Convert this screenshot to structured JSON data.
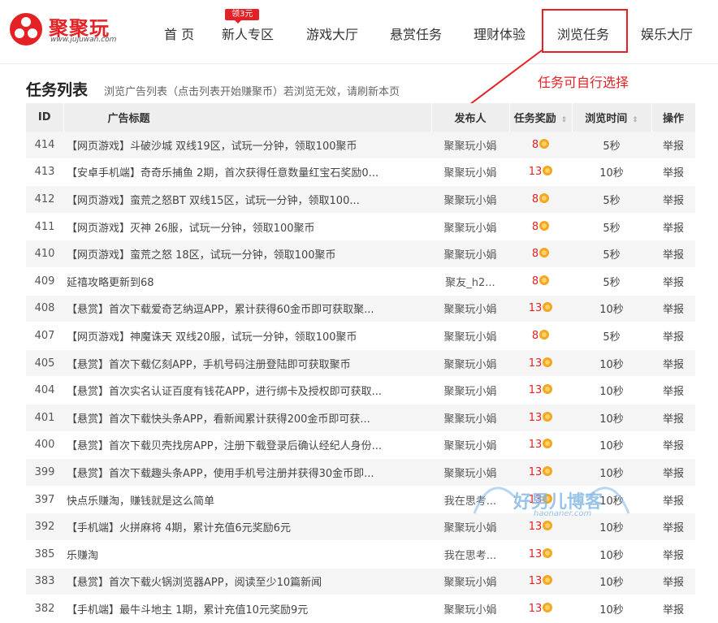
{
  "header": {
    "logo_text": "聚聚玩",
    "logo_url": "www.jujuwan.com",
    "badge": "领3元",
    "nav": [
      "首 页",
      "新人专区",
      "游戏大厅",
      "悬赏任务",
      "理财体验",
      "浏览任务",
      "娱乐大厅"
    ]
  },
  "section": {
    "title": "任务列表",
    "subtitle": "浏览广告列表（点击列表开始赚聚币）若浏览无效，请刷新本页"
  },
  "annotation": "任务可自行选择",
  "table": {
    "headers": [
      "ID",
      "广告标题",
      "发布人",
      "任务奖励",
      "浏览时间",
      "操作"
    ],
    "rows": [
      [
        "414",
        "【网页游戏】斗破沙城 双线19区，试玩一分钟，领取100聚币",
        "聚聚玩小娟",
        "8",
        "5秒",
        "举报"
      ],
      [
        "413",
        "【安卓手机端】奇奇乐捕鱼 2期，首次获得任意数量红宝石奖励0...",
        "聚聚玩小娟",
        "13",
        "10秒",
        "举报"
      ],
      [
        "412",
        "【网页游戏】蛮荒之怒BT 双线15区，试玩一分钟，领取100...",
        "聚聚玩小娟",
        "8",
        "5秒",
        "举报"
      ],
      [
        "411",
        "【网页游戏】灭神 26服，试玩一分钟，领取100聚币",
        "聚聚玩小娟",
        "8",
        "5秒",
        "举报"
      ],
      [
        "410",
        "【网页游戏】蛮荒之怒 18区，试玩一分钟，领取100聚币",
        "聚聚玩小娟",
        "8",
        "5秒",
        "举报"
      ],
      [
        "409",
        "延禧攻略更新到68",
        "聚友_h2...",
        "8",
        "5秒",
        "举报"
      ],
      [
        "408",
        "【悬赏】首次下载爱奇艺纳逗APP，累计获得60金币即可获取聚...",
        "聚聚玩小娟",
        "13",
        "10秒",
        "举报"
      ],
      [
        "407",
        "【网页游戏】神魔诛天 双线20服，试玩一分钟，领取100聚币",
        "聚聚玩小娟",
        "8",
        "5秒",
        "举报"
      ],
      [
        "405",
        "【悬赏】首次下载亿刻APP，手机号码注册登陆即可获取聚币",
        "聚聚玩小娟",
        "13",
        "10秒",
        "举报"
      ],
      [
        "404",
        "【悬赏】首次实名认证百度有钱花APP，进行绑卡及授权即可获取...",
        "聚聚玩小娟",
        "13",
        "10秒",
        "举报"
      ],
      [
        "401",
        "【悬赏】首次下载快头条APP，看新闻累计获得200金币即可获...",
        "聚聚玩小娟",
        "13",
        "10秒",
        "举报"
      ],
      [
        "400",
        "【悬赏】首次下载贝壳找房APP，注册下载登录后确认经纪人身份...",
        "聚聚玩小娟",
        "13",
        "10秒",
        "举报"
      ],
      [
        "399",
        "【悬赏】首次下载趣头条APP，使用手机号注册并获得30金币即...",
        "聚聚玩小娟",
        "13",
        "10秒",
        "举报"
      ],
      [
        "397",
        "快点乐赚淘，赚钱就是这么简单",
        "我在思考...",
        "13",
        "10秒",
        "举报"
      ],
      [
        "392",
        "【手机端】火拼麻将 4期，累计充值6元奖励6元",
        "聚聚玩小娟",
        "13",
        "10秒",
        "举报"
      ],
      [
        "385",
        "乐赚淘",
        "我在思考...",
        "13",
        "10秒",
        "举报"
      ],
      [
        "383",
        "【悬赏】首次下载火锅浏览器APP，阅读至少10篇新闻",
        "聚聚玩小娟",
        "13",
        "10秒",
        "举报"
      ],
      [
        "382",
        "【手机端】最牛斗地主 1期，累计充值10元奖励9元",
        "聚聚玩小娟",
        "13",
        "10秒",
        "举报"
      ]
    ]
  },
  "watermark": {
    "text": "好男儿博客",
    "url": "haonaner.com"
  },
  "colors": {
    "accent": "#e52125",
    "coin": "#f5a623",
    "header_bg": "#eeeeee",
    "stripe": "#f5f5f5"
  }
}
